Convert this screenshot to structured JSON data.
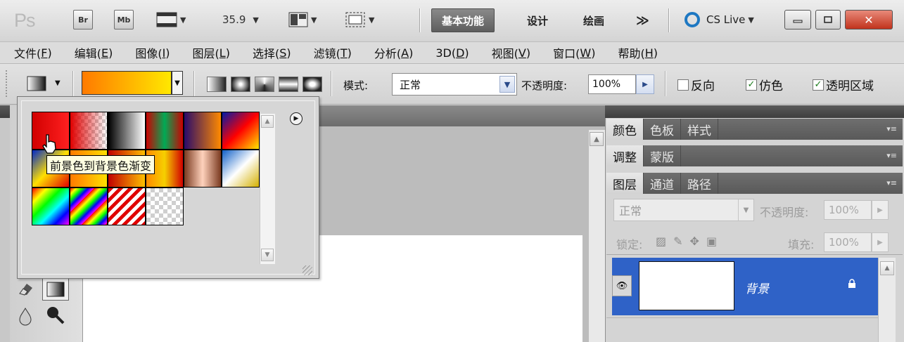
{
  "titlebar": {
    "logo": "Ps",
    "bridge": "Br",
    "minibridge": "Mb",
    "zoom": "35.9",
    "workspaces": [
      "基本功能",
      "设计",
      "绘画"
    ],
    "more": "≫",
    "cs_live": "CS Live"
  },
  "menubar": {
    "items": [
      {
        "label": "文件(",
        "key": "F"
      },
      {
        "label": "编辑(",
        "key": "E"
      },
      {
        "label": "图像(",
        "key": "I"
      },
      {
        "label": "图层(",
        "key": "L"
      },
      {
        "label": "选择(",
        "key": "S"
      },
      {
        "label": "滤镜(",
        "key": "T"
      },
      {
        "label": "分析(",
        "key": "A"
      },
      {
        "label": "3D(",
        "key": "D"
      },
      {
        "label": "视图(",
        "key": "V"
      },
      {
        "label": "窗口(",
        "key": "W"
      },
      {
        "label": "帮助(",
        "key": "H"
      }
    ]
  },
  "options": {
    "mode_label": "模式:",
    "mode_value": "正常",
    "opacity_label": "不透明度:",
    "opacity_value": "100%",
    "reverse": {
      "label": "反向",
      "checked": false
    },
    "dither": {
      "label": "仿色",
      "checked": true
    },
    "transparency": {
      "label": "透明区域",
      "checked": true
    }
  },
  "picker": {
    "tooltip": "前景色到背景色渐变"
  },
  "panels": {
    "group1": [
      "颜色",
      "色板",
      "样式"
    ],
    "group2": [
      "调整",
      "蒙版"
    ],
    "group3": [
      "图层",
      "通道",
      "路径"
    ],
    "blend_mode": "正常",
    "opacity_label": "不透明度:",
    "opacity_value": "100%",
    "lock_label": "锁定:",
    "fill_label": "填充:",
    "fill_value": "100%",
    "layer_name": "背景"
  },
  "icons": [
    "ps-logo",
    "bridge-icon",
    "minibridge-icon",
    "view-extras-icon",
    "arrange-icon",
    "screen-mode-icon",
    "cs-live-icon",
    "minimize-icon",
    "restore-icon",
    "close-icon",
    "gradient-tool-icon",
    "eye-icon",
    "lock-icon",
    "picker-menu-icon",
    "hand-cursor-icon"
  ]
}
